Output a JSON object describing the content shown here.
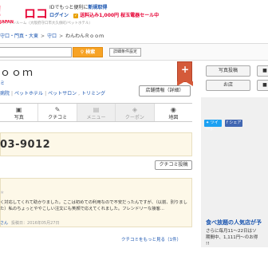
{
  "header": {
    "logo_text": "ロコ",
    "logo_sub": "JAPAN",
    "line1_prefix": "IDでもっと便利に",
    "line1_link": "新規取得",
    "login": "ログイン",
    "promo": "送料込み1,000円 桜玉電器セール中",
    "address_strip": "ワンワンルーム（大阪府守口市大久保町/ペットホテル）"
  },
  "breadcrumb": [
    "守口・門真・大東",
    "守口",
    "わんわんＲｏｏｍ"
  ],
  "search": {
    "placeholder": "",
    "button_label": "検索",
    "detail_label": "詳細条件設定"
  },
  "shop": {
    "title": "ｏｏｍ",
    "subcategory": "ミ",
    "categories": [
      "病院",
      "ペットホテル",
      "ペットサロン",
      "トリミング"
    ],
    "info_button": "店舗情報（詳細）",
    "phone": "03-9012",
    "flag_symbol": "+"
  },
  "tabs": [
    {
      "label": "写真",
      "icon": "camera-icon",
      "glyph": "▣",
      "enabled": true
    },
    {
      "label": "クチコミ",
      "icon": "comment-icon",
      "glyph": "✎",
      "enabled": true
    },
    {
      "label": "メニュー",
      "icon": "menu-icon",
      "glyph": "▤",
      "enabled": false
    },
    {
      "label": "クーポン",
      "icon": "coupon-icon",
      "glyph": "◈",
      "enabled": false
    },
    {
      "label": "地図",
      "icon": "map-icon",
      "glyph": "◉",
      "enabled": true
    }
  ],
  "review_actions": {
    "post_label": "クチコミ投稿"
  },
  "review": {
    "stars": "★",
    "text": "く対応してくれて助かりました。ここは初めての利用なので不安だったんですが、（以前、別りました）私のちょっとややこしい注文にも笑顔で応えてくれました。フレンドリーな接客...",
    "author": "さん",
    "date_label": "投稿日：",
    "date": "2016年05月27日"
  },
  "more_link": "クチコミをもっと見る（1件）",
  "sidebar": {
    "photo_post": "写真投稿",
    "post2": "■",
    "bookmark": "お店",
    "post4": "■",
    "tweet": "ツイート",
    "share": "シェア",
    "feature_title": "食べ放題の人気店が予",
    "feature_text_line1": "さらに毎月11〜22日はソ",
    "feature_text_line2": "期間中、1,111円〜のお得",
    "feature_text_line3": "!!"
  },
  "colors": {
    "brand_red": "#ff0033",
    "link_blue": "#1a55b0",
    "search_orange": "#f7a325",
    "flag_red": "#d45a3a",
    "highlight_bg": "#fdf8e8"
  }
}
